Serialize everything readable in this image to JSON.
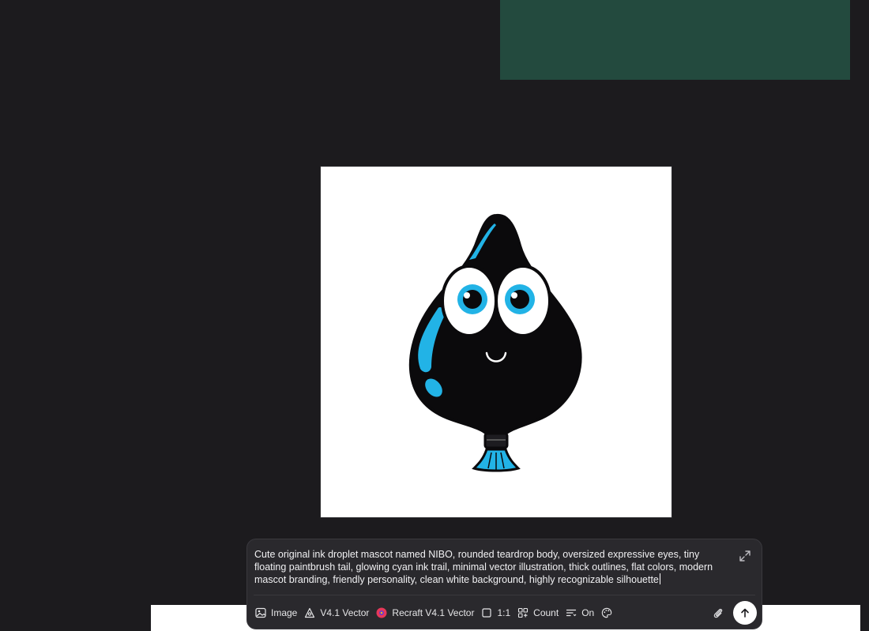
{
  "prompt": {
    "text": "Cute original ink droplet mascot named NIBO, rounded teardrop body, oversized expressive eyes, tiny floating paintbrush tail, glowing cyan ink trail, minimal vector illustration, thick outlines, flat colors, modern mascot branding, friendly personality, clean white background, highly recognizable silhouette"
  },
  "toolbar": {
    "image_label": "Image",
    "style_label": "V4.1 Vector",
    "model_label": "Recraft V4.1 Vector",
    "ratio_label": "1:1",
    "count_label": "Count",
    "toggle_label": "On"
  },
  "icons": {
    "image": "image-icon",
    "style": "style-icon",
    "model": "model-logo-icon",
    "ratio": "square-icon",
    "count": "grid-icon",
    "toggle": "list-icon",
    "palette": "palette-icon",
    "attach": "paperclip-icon",
    "send": "arrow-up-icon",
    "expand": "expand-icon"
  },
  "colors": {
    "background": "#1c1b1e",
    "panel": "#2a292d",
    "frame_green": "#234a3e",
    "mascot_body": "#0b0a0c",
    "mascot_cyan": "#22b3e6"
  }
}
